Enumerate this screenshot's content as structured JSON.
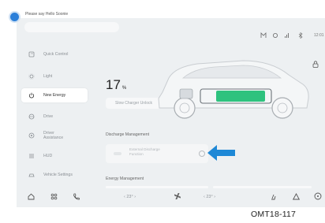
{
  "topbar": {
    "voice_prompt": "Please say Hello Soonie",
    "status_icons": [
      "user-icon",
      "connected-icon",
      "signal-icon",
      "bluetooth-icon"
    ],
    "time": "12:01"
  },
  "sidebar": {
    "items": [
      {
        "label": "Quick Control",
        "icon": "quick-control-icon"
      },
      {
        "label": "Light",
        "icon": "light-icon"
      },
      {
        "label": "New Energy",
        "icon": "power-icon",
        "active": true
      },
      {
        "label": "Drive",
        "icon": "drive-icon"
      },
      {
        "label": "Driver\nAssistance",
        "icon": "driver-assistance-icon"
      },
      {
        "label": "HUD",
        "icon": "hud-icon"
      },
      {
        "label": "Vehicle Settings",
        "icon": "vehicle-settings-icon"
      }
    ]
  },
  "main": {
    "charge_value": "17",
    "charge_unit": "%",
    "charger_button": "Slow Charger Unlock",
    "discharge_title": "Discharge Management",
    "discharge_item": "External Discharge\nFunction",
    "energy_title": "Energy Management"
  },
  "bottombar": {
    "left_temp": "‹  23°  ›",
    "right_temp": "‹  23°  ›"
  },
  "caption": "OMT18-117",
  "colors": {
    "accent": "#2b7fd9",
    "arrow": "#1e88d6",
    "battery": "#2ec27e"
  }
}
